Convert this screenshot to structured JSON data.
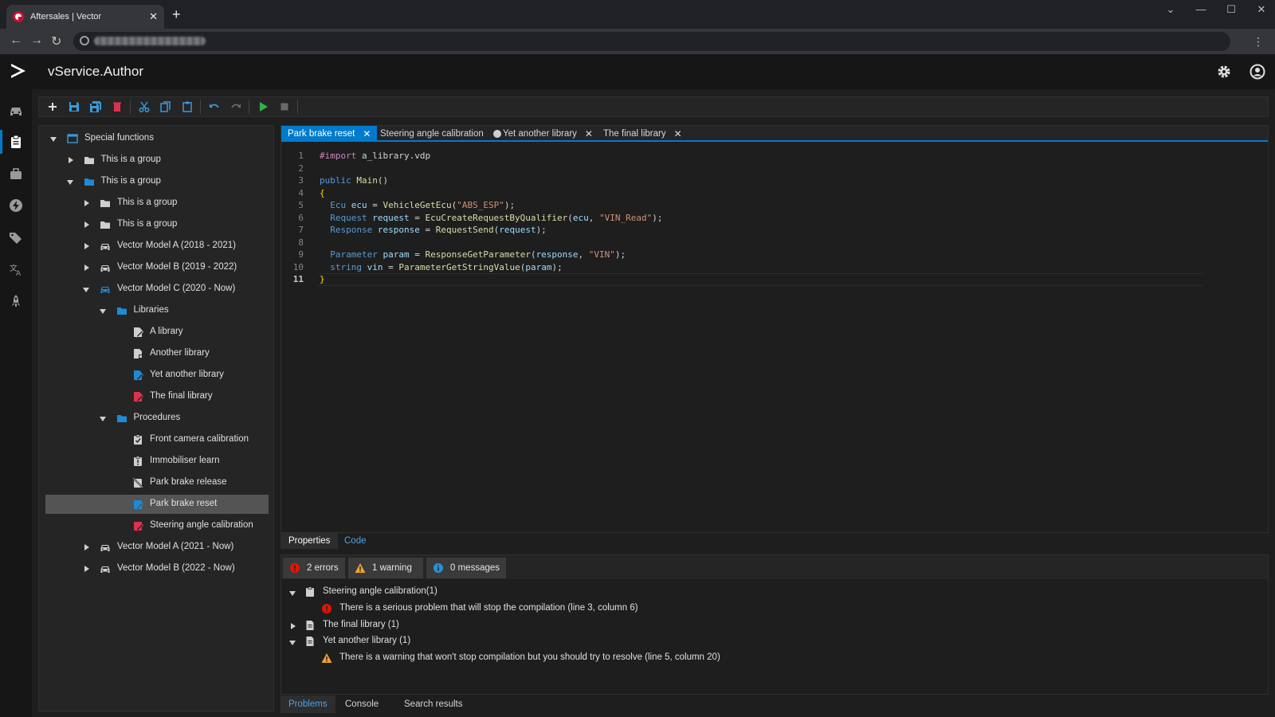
{
  "browser": {
    "tab_title": "Aftersales | Vector",
    "tab_close": "✕",
    "new_tab": "+",
    "controls": [
      "⌄",
      "—",
      "☐",
      "✕"
    ]
  },
  "app": {
    "title": "vService.Author"
  },
  "tree": [
    {
      "label": "Special functions",
      "level": 0,
      "state": "expanded",
      "icon": "window-icon"
    },
    {
      "label": "This is a group",
      "level": 1,
      "state": "collapsed",
      "icon": "folder-icon"
    },
    {
      "label": "This is a group",
      "level": 1,
      "state": "expanded",
      "icon": "folder-open-icon"
    },
    {
      "label": "This is a group",
      "level": 2,
      "state": "collapsed",
      "icon": "folder-icon"
    },
    {
      "label": "This is a group",
      "level": 2,
      "state": "collapsed",
      "icon": "folder-icon"
    },
    {
      "label": "Vector Model A (2018 - 2021)",
      "level": 2,
      "state": "collapsed",
      "icon": "car-icon"
    },
    {
      "label": "Vector Model B (2019 - 2022)",
      "level": 2,
      "state": "collapsed",
      "icon": "car-icon"
    },
    {
      "label": "Vector Model C (2020 - Now)",
      "level": 2,
      "state": "expanded",
      "icon": "car-blue-icon"
    },
    {
      "label": "Libraries",
      "level": 3,
      "state": "expanded",
      "icon": "folder-open-icon"
    },
    {
      "label": "A library",
      "level": 4,
      "state": "none",
      "icon": "library-edit-icon"
    },
    {
      "label": "Another library",
      "level": 4,
      "state": "none",
      "icon": "library-icon"
    },
    {
      "label": "Yet another library",
      "level": 4,
      "state": "none",
      "icon": "library-blue-icon"
    },
    {
      "label": "The final library",
      "level": 4,
      "state": "none",
      "icon": "library-red-icon"
    },
    {
      "label": "Procedures",
      "level": 3,
      "state": "expanded",
      "icon": "folder-open-icon"
    },
    {
      "label": "Front camera calibration",
      "level": 4,
      "state": "none",
      "icon": "procedure-check-icon"
    },
    {
      "label": "Immobiliser learn",
      "level": 4,
      "state": "none",
      "icon": "procedure-warning-icon"
    },
    {
      "label": "Park brake release",
      "level": 4,
      "state": "none",
      "icon": "procedure-disabled-icon"
    },
    {
      "label": "Park brake reset",
      "level": 4,
      "state": "none",
      "icon": "procedure-blue-icon",
      "selected": true
    },
    {
      "label": "Steering angle calibration",
      "level": 4,
      "state": "none",
      "icon": "procedure-red-icon"
    },
    {
      "label": "Vector Model A (2021 - Now)",
      "level": 2,
      "state": "collapsed",
      "icon": "car-icon"
    },
    {
      "label": "Vector Model B (2022 - Now)",
      "level": 2,
      "state": "collapsed",
      "icon": "car-icon"
    }
  ],
  "editor": {
    "tabs": [
      {
        "label": "Park brake reset",
        "active": true,
        "close": "✕"
      },
      {
        "label": "Steering angle calibration",
        "modified": true
      },
      {
        "label": "Yet another library",
        "close": "✕"
      },
      {
        "label": "The final library",
        "close": "✕"
      }
    ],
    "current_line": 11,
    "lines": [
      [
        [
          "pr",
          "#import"
        ],
        [
          "p",
          " a_library.vdp"
        ]
      ],
      [],
      [
        [
          "k",
          "public"
        ],
        [
          "p",
          " "
        ],
        [
          "f",
          "Main"
        ],
        [
          "p",
          "()"
        ]
      ],
      [
        [
          "br",
          "{"
        ]
      ],
      [
        [
          "p",
          "  "
        ],
        [
          "k",
          "Ecu"
        ],
        [
          "p",
          " "
        ],
        [
          "v",
          "ecu"
        ],
        [
          "p",
          " = "
        ],
        [
          "f",
          "VehicleGetEcu"
        ],
        [
          "p",
          "("
        ],
        [
          "s",
          "\"ABS_ESP\""
        ],
        [
          "p",
          ");"
        ]
      ],
      [
        [
          "p",
          "  "
        ],
        [
          "k",
          "Request"
        ],
        [
          "p",
          " "
        ],
        [
          "v",
          "request"
        ],
        [
          "p",
          " = "
        ],
        [
          "f",
          "EcuCreateRequestByQualifier"
        ],
        [
          "p",
          "("
        ],
        [
          "v",
          "ecu"
        ],
        [
          "p",
          ", "
        ],
        [
          "s",
          "\"VIN_Read\""
        ],
        [
          "p",
          ");"
        ]
      ],
      [
        [
          "p",
          "  "
        ],
        [
          "k",
          "Response"
        ],
        [
          "p",
          " "
        ],
        [
          "v",
          "response"
        ],
        [
          "p",
          " = "
        ],
        [
          "f",
          "RequestSend"
        ],
        [
          "p",
          "("
        ],
        [
          "v",
          "request"
        ],
        [
          "p",
          ");"
        ]
      ],
      [],
      [
        [
          "p",
          "  "
        ],
        [
          "k",
          "Parameter"
        ],
        [
          "p",
          " "
        ],
        [
          "v",
          "param"
        ],
        [
          "p",
          " = "
        ],
        [
          "f",
          "ResponseGetParameter"
        ],
        [
          "p",
          "("
        ],
        [
          "v",
          "response"
        ],
        [
          "p",
          ", "
        ],
        [
          "s",
          "\"VIN\""
        ],
        [
          "p",
          ");"
        ]
      ],
      [
        [
          "p",
          "  "
        ],
        [
          "k",
          "string"
        ],
        [
          "p",
          " "
        ],
        [
          "v",
          "vin"
        ],
        [
          "p",
          " = "
        ],
        [
          "f",
          "ParameterGetStringValue"
        ],
        [
          "p",
          "("
        ],
        [
          "v",
          "param"
        ],
        [
          "p",
          ");"
        ]
      ],
      [
        [
          "br",
          "}"
        ]
      ]
    ]
  },
  "panel_tabs": [
    {
      "label": "Properties",
      "active": true
    },
    {
      "label": "Code"
    }
  ],
  "problems": {
    "filters": [
      {
        "label": "2 errors",
        "icon": "error-icon"
      },
      {
        "label": "1 warning",
        "icon": "warning-icon"
      },
      {
        "label": "0 messages",
        "icon": "info-icon"
      }
    ],
    "rows": [
      {
        "label": "Steering angle calibration(1)",
        "type": "group",
        "state": "expanded",
        "icon": "clipboard-icon"
      },
      {
        "label": "There is a serious problem that will stop the compilation (line 3, column 6)",
        "type": "error"
      },
      {
        "label": "The final library (1)",
        "type": "group",
        "state": "collapsed",
        "icon": "file-icon"
      },
      {
        "label": "Yet another library (1)",
        "type": "group",
        "state": "expanded",
        "icon": "file-icon"
      },
      {
        "label": "There is a warning that won't stop compilation but you should try to resolve (line 5, column 20)",
        "type": "warning"
      }
    ]
  },
  "footer_tabs": [
    {
      "label": "Problems",
      "active": true
    },
    {
      "label": "Console"
    },
    {
      "label": "Search results"
    }
  ],
  "colors": {
    "accent": "#007acc",
    "error": "#e51400",
    "warning": "#f0a030",
    "info": "#2a8fd6",
    "play": "#2fb344",
    "delete": "#e0314b"
  }
}
